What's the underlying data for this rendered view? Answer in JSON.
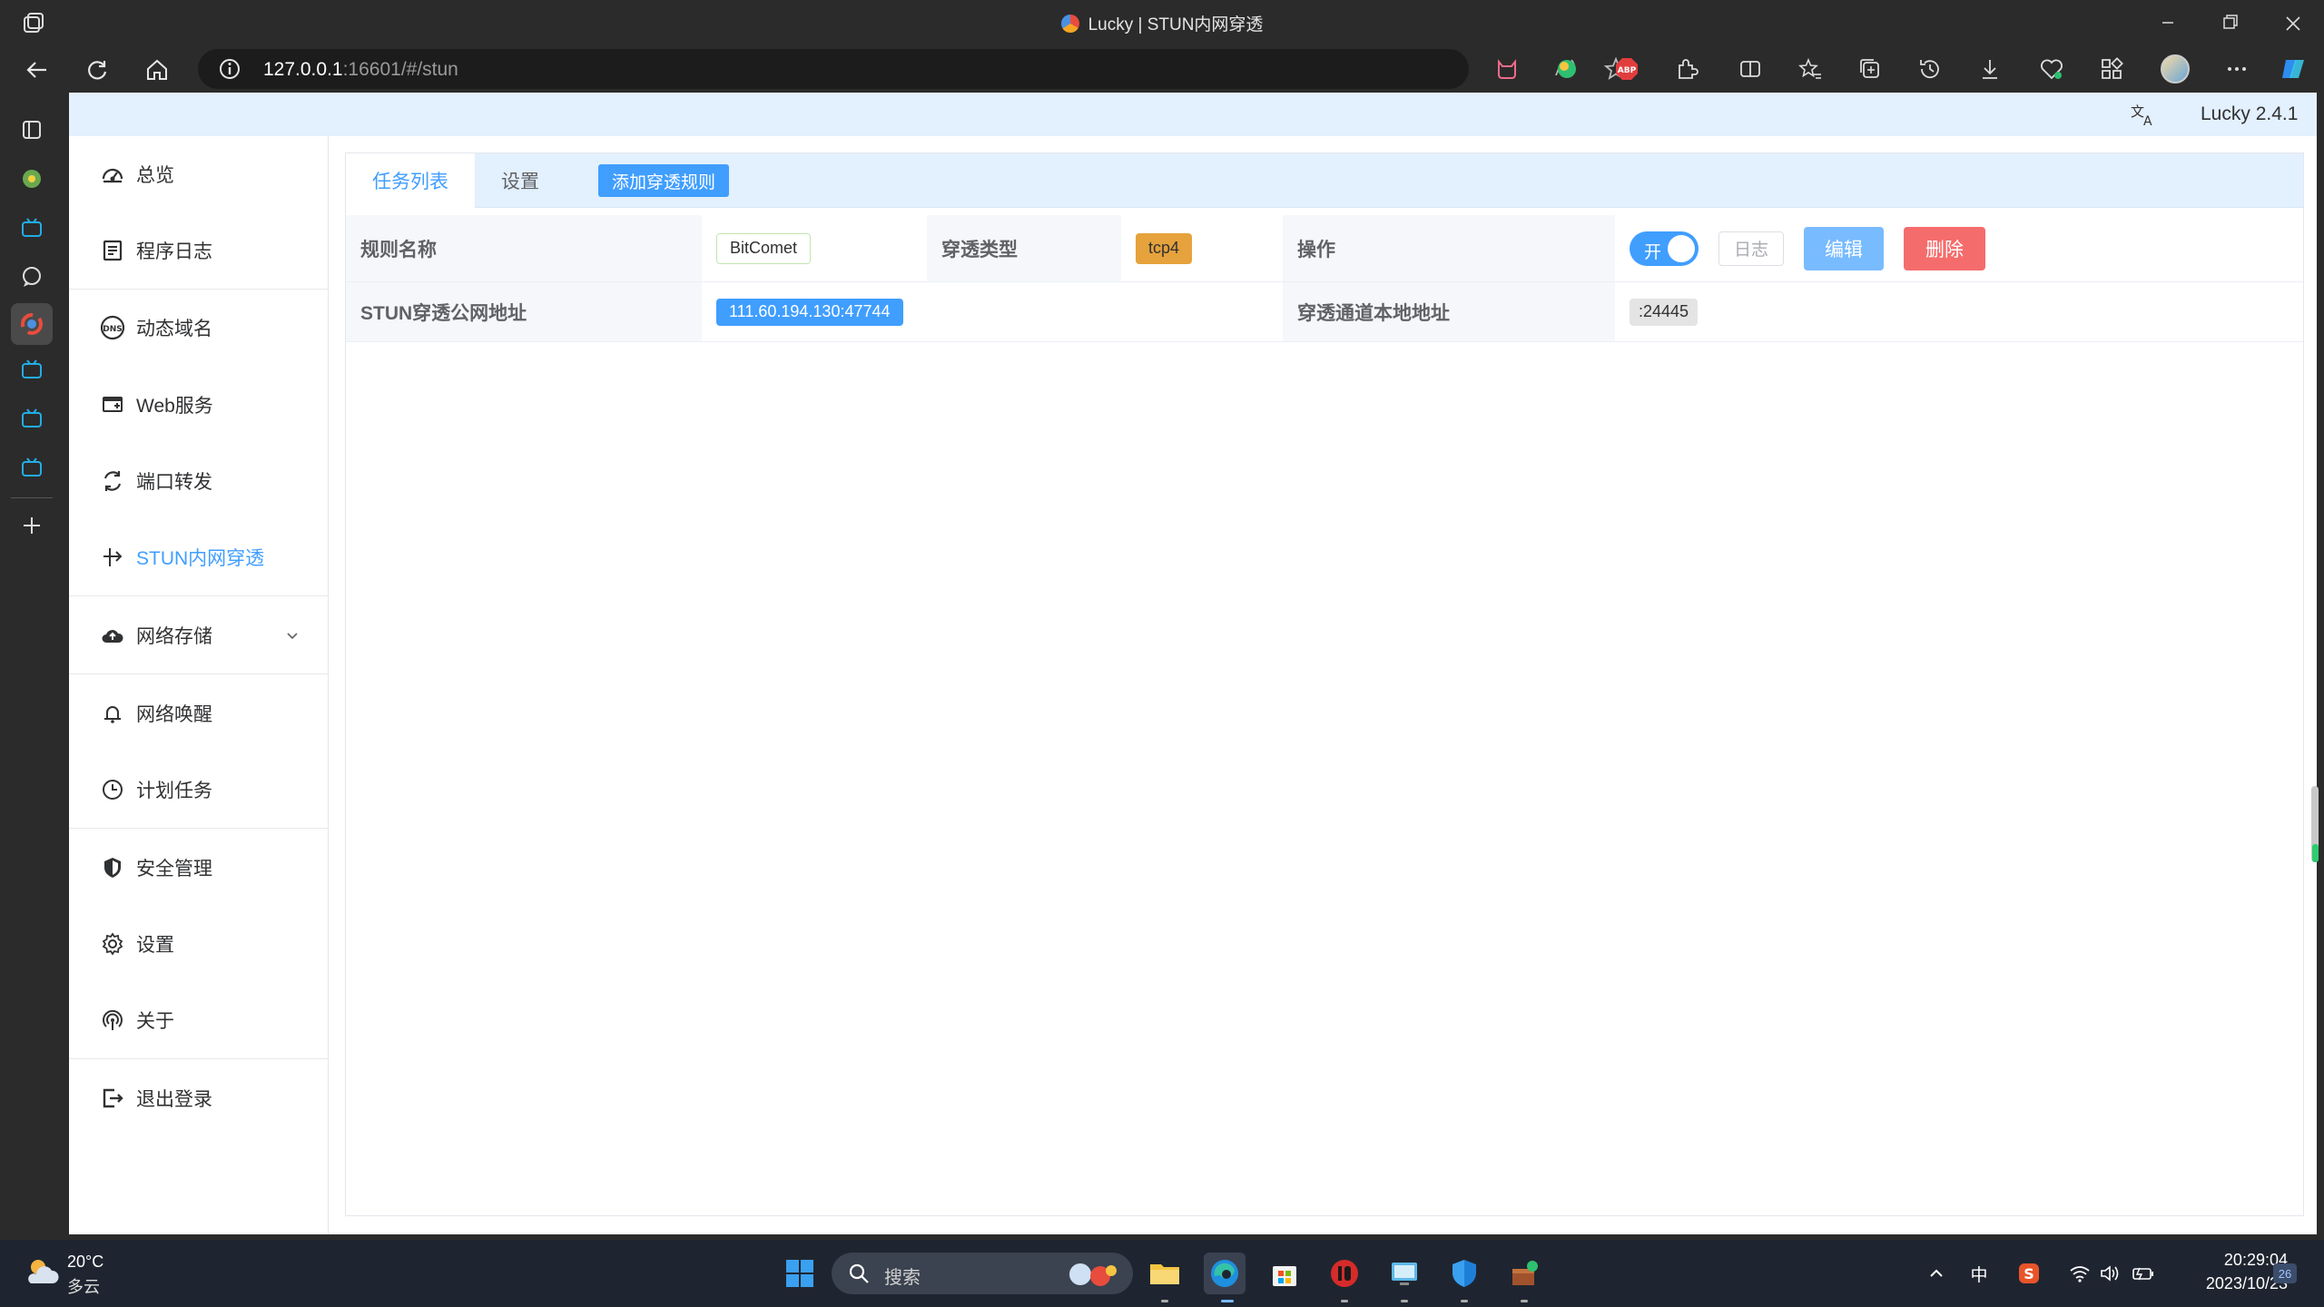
{
  "browser": {
    "window_title": "Lucky | STUN内网穿透",
    "url_host": "127.0.0.1",
    "url_rest": ":16601/#/stun"
  },
  "app": {
    "version": "Lucky 2.4.1"
  },
  "menu": {
    "items": [
      {
        "label": "总览",
        "icon": "dashboard-icon"
      },
      {
        "label": "程序日志",
        "icon": "log-icon"
      },
      {
        "label": "动态域名",
        "icon": "dns-icon"
      },
      {
        "label": "Web服务",
        "icon": "web-icon"
      },
      {
        "label": "端口转发",
        "icon": "port-forward-icon"
      },
      {
        "label": "STUN内网穿透",
        "icon": "stun-icon"
      },
      {
        "label": "网络存储",
        "icon": "cloud-icon"
      },
      {
        "label": "网络唤醒",
        "icon": "bell-icon"
      },
      {
        "label": "计划任务",
        "icon": "clock-icon"
      },
      {
        "label": "安全管理",
        "icon": "shield-icon"
      },
      {
        "label": "设置",
        "icon": "gear-icon"
      },
      {
        "label": "关于",
        "icon": "about-icon"
      },
      {
        "label": "退出登录",
        "icon": "logout-icon"
      }
    ],
    "active": "STUN内网穿透"
  },
  "tabs": {
    "list": "任务列表",
    "settings": "设置",
    "add_rule": "添加穿透规则"
  },
  "rule": {
    "name_label": "规则名称",
    "name_value": "BitComet",
    "type_label": "穿透类型",
    "type_value": "tcp4",
    "ops_label": "操作",
    "switch_label": "开",
    "log_button": "日志",
    "edit_button": "编辑",
    "delete_button": "删除",
    "public_addr_label": "STUN穿透公网地址",
    "public_addr_value": "111.60.194.130:47744",
    "local_addr_label": "穿透通道本地地址",
    "local_addr_value": ":24445"
  },
  "taskbar": {
    "weather_temp": "20°C",
    "weather_desc": "多云",
    "search_placeholder": "搜索",
    "ime": "中",
    "time": "20:29:04",
    "date": "2023/10/23",
    "notifications": "26"
  },
  "colors": {
    "accent": "#409eff",
    "warning": "#e6a23c",
    "danger": "#f56c6c",
    "header_bg": "#e3f0fd"
  }
}
